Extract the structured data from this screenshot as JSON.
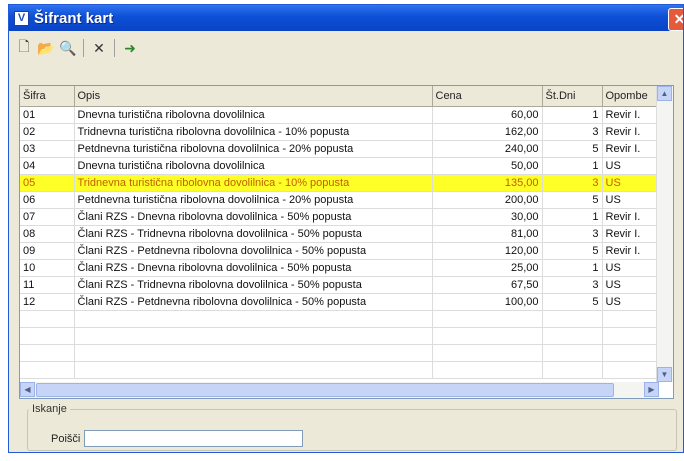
{
  "window": {
    "title": "Šifrant kart",
    "app_icon": "V",
    "close": "✕"
  },
  "toolbar": {
    "new": "🗋",
    "open": "📂",
    "preview": "🔍",
    "delete": "✕",
    "exit": "➜"
  },
  "table": {
    "headers": [
      "Šifra",
      "Opis",
      "Cena",
      "Št.Dni",
      "Opombe"
    ],
    "rows": [
      [
        "01",
        "Dnevna turistična ribolovna dovolilnica",
        "60,00",
        "1",
        "Revir I."
      ],
      [
        "02",
        "Tridnevna turistična ribolovna dovolilnica - 10% popusta",
        "162,00",
        "3",
        "Revir I."
      ],
      [
        "03",
        "Petdnevna turistična ribolovna dovolilnica - 20% popusta",
        "240,00",
        "5",
        "Revir I."
      ],
      [
        "04",
        "Dnevna turistična ribolovna dovolilnica",
        "50,00",
        "1",
        "US"
      ],
      [
        "05",
        "Tridnevna turistična ribolovna dovolilnica - 10% popusta",
        "135,00",
        "3",
        "US"
      ],
      [
        "06",
        "Petdnevna turistična ribolovna dovolilnica - 20% popusta",
        "200,00",
        "5",
        "US"
      ],
      [
        "07",
        "Člani RZS - Dnevna ribolovna dovolilnica  - 50% popusta",
        "30,00",
        "1",
        "Revir I."
      ],
      [
        "08",
        "Člani RZS - Tridnevna ribolovna dovolilnica  - 50% popusta",
        "81,00",
        "3",
        "Revir I."
      ],
      [
        "09",
        "Člani RZS - Petdnevna ribolovna dovolilnica  - 50% popusta",
        "120,00",
        "5",
        "Revir I."
      ],
      [
        "10",
        "Člani RZS - Dnevna ribolovna dovolilnica - 50% popusta",
        "25,00",
        "1",
        "US"
      ],
      [
        "11",
        "Člani RZS - Tridnevna ribolovna dovolilnica - 50% popusta",
        "67,50",
        "3",
        "US"
      ],
      [
        "12",
        "Člani RZS - Petdnevna ribolovna dovolilnica - 50% popusta",
        "100,00",
        "5",
        "US"
      ]
    ],
    "selected_row": "05",
    "highlight_color": "#ffff28"
  },
  "search": {
    "group_label": "Iskanje",
    "label": "Poišči",
    "value": ""
  }
}
